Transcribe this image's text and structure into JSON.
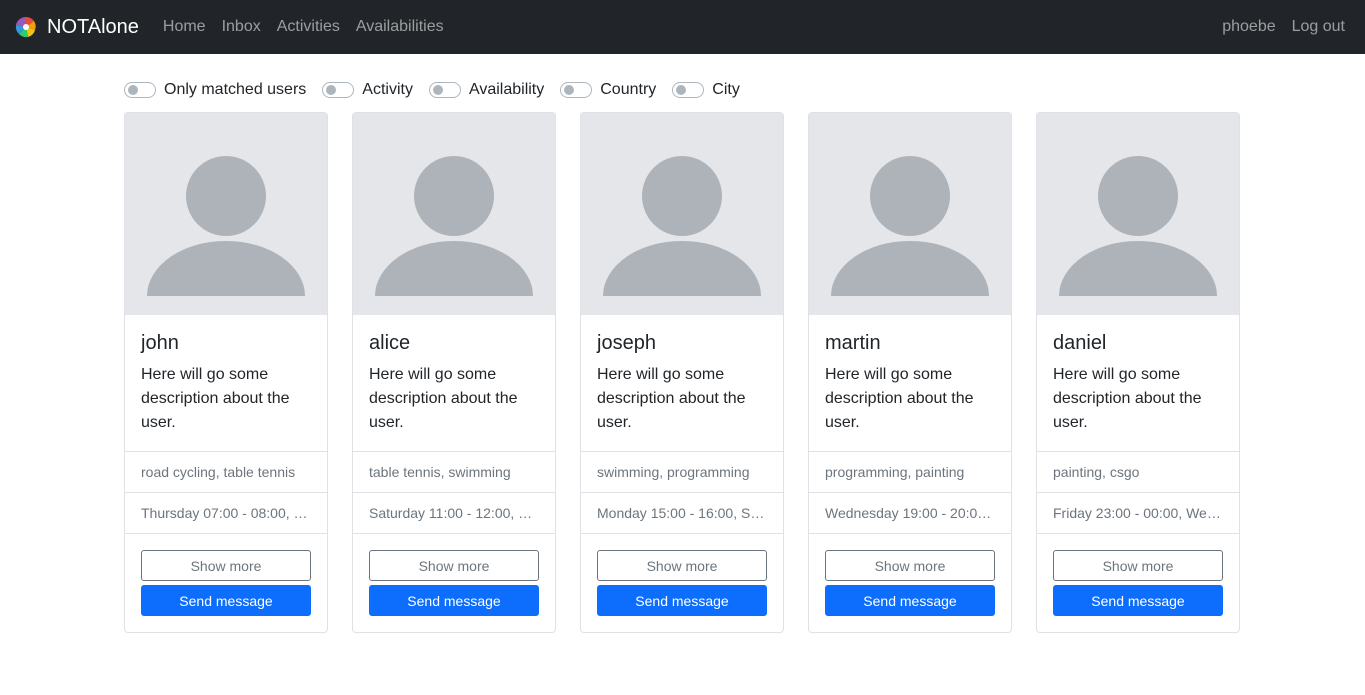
{
  "app": {
    "brand": "NOTAlone",
    "brand_icon": "colorful-pinwheel-icon"
  },
  "nav": {
    "items": [
      {
        "label": "Home"
      },
      {
        "label": "Inbox"
      },
      {
        "label": "Activities"
      },
      {
        "label": "Availabilities"
      }
    ],
    "user": "phoebe",
    "logout": "Log out"
  },
  "filters": [
    {
      "label": "Only matched users",
      "checked": false
    },
    {
      "label": "Activity",
      "checked": false
    },
    {
      "label": "Availability",
      "checked": false
    },
    {
      "label": "Country",
      "checked": false
    },
    {
      "label": "City",
      "checked": false
    }
  ],
  "cards": [
    {
      "name": "john",
      "description": "Here will go some description about the user.",
      "activities": "road cycling, table tennis",
      "availability": "Thursday 07:00 - 08:00, …",
      "show_more": "Show more",
      "send_message": "Send message"
    },
    {
      "name": "alice",
      "description": "Here will go some description about the user.",
      "activities": "table tennis, swimming",
      "availability": "Saturday 11:00 - 12:00, …",
      "show_more": "Show more",
      "send_message": "Send message"
    },
    {
      "name": "joseph",
      "description": "Here will go some description about the user.",
      "activities": "swimming, programming",
      "availability": "Monday 15:00 - 16:00, S…",
      "show_more": "Show more",
      "send_message": "Send message"
    },
    {
      "name": "martin",
      "description": "Here will go some description about the user.",
      "activities": "programming, painting",
      "availability": "Wednesday 19:00 - 20:0…",
      "show_more": "Show more",
      "send_message": "Send message"
    },
    {
      "name": "daniel",
      "description": "Here will go some description about the user.",
      "activities": "painting, csgo",
      "availability": "Friday 23:00 - 00:00, We…",
      "show_more": "Show more",
      "send_message": "Send message"
    }
  ]
}
